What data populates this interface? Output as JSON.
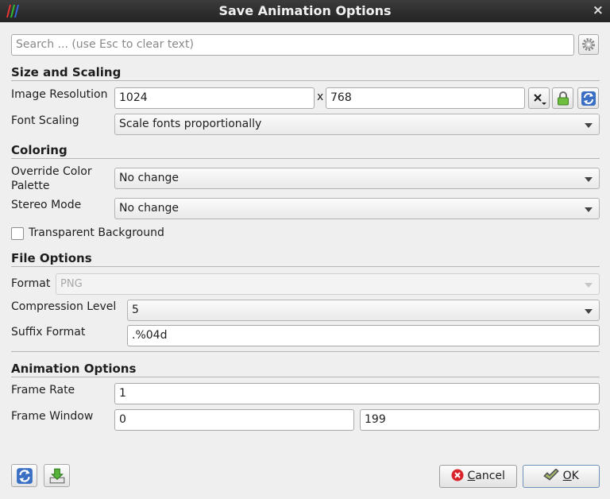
{
  "window": {
    "title": "Save Animation Options",
    "close_glyph": "×"
  },
  "search": {
    "placeholder": "Search ... (use Esc to clear text)",
    "value": ""
  },
  "sections": {
    "size": "Size and Scaling",
    "coloring": "Coloring",
    "file": "File Options",
    "animation": "Animation Options"
  },
  "size_scaling": {
    "resolution_label": "Image Resolution",
    "width": "1024",
    "separator": "x",
    "height": "768",
    "font_scaling_label": "Font Scaling",
    "font_scaling_value": "Scale fonts proportionally"
  },
  "coloring": {
    "palette_label_line1": "Override Color",
    "palette_label_line2": "Palette",
    "palette_value": "No change",
    "stereo_label": "Stereo Mode",
    "stereo_value": "No change",
    "transparent_label": "Transparent Background",
    "transparent_checked": false
  },
  "file_options": {
    "format_label": "Format",
    "format_value": "PNG",
    "compression_label": "Compression Level",
    "compression_value": "5",
    "suffix_label": "Suffix Format",
    "suffix_value": ".%04d"
  },
  "animation": {
    "frame_rate_label": "Frame Rate",
    "frame_rate_value": "1",
    "frame_window_label": "Frame Window",
    "frame_window_start": "0",
    "frame_window_end": "199"
  },
  "buttons": {
    "cancel_mnemonic": "C",
    "cancel_rest": "ancel",
    "ok_mnemonic": "O",
    "ok_rest": "K"
  },
  "icons": {
    "app": "paraview-logo-icon",
    "settings": "gear-icon",
    "clear_resolution": "clear-dropdown-icon",
    "lock_aspect": "lock-icon",
    "reset": "refresh-icon",
    "save_defaults": "save-download-icon",
    "cancel": "cancel-icon",
    "ok": "ok-check-icon"
  }
}
